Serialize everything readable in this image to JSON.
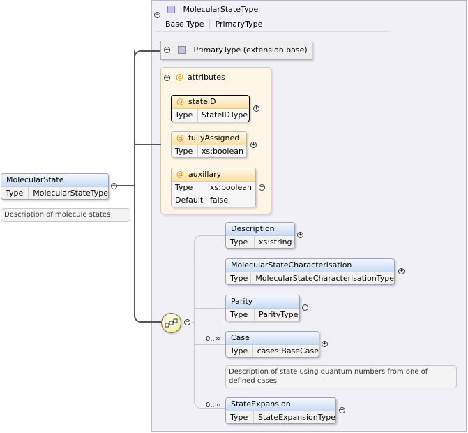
{
  "type_panel": {
    "name": "MolecularStateType",
    "base_type_label": "Base Type",
    "base_type_value": "PrimaryType",
    "extension_label": "PrimaryType (extension base)"
  },
  "attributes_group": {
    "title": "attributes",
    "items": [
      {
        "name": "stateID",
        "rows": [
          {
            "key": "Type",
            "value": "StateIDType"
          }
        ]
      },
      {
        "name": "fullyAssigned",
        "rows": [
          {
            "key": "Type",
            "value": "xs:boolean"
          }
        ]
      },
      {
        "name": "auxillary",
        "rows": [
          {
            "key": "Type",
            "value": "xs:boolean"
          },
          {
            "key": "Default",
            "value": "false"
          }
        ]
      }
    ]
  },
  "root_element": {
    "name": "MolecularState",
    "type_label": "Type",
    "type_value": "MolecularStateType",
    "description": "Description of molecule states"
  },
  "sequence": {
    "children": [
      {
        "name": "Description",
        "type_label": "Type",
        "type_value": "xs:string"
      },
      {
        "name": "MolecularStateCharacterisation",
        "type_label": "Type",
        "type_value": "MolecularStateCharacterisationType"
      },
      {
        "name": "Parity",
        "type_label": "Type",
        "type_value": "ParityType"
      },
      {
        "name": "Case",
        "type_label": "Type",
        "type_value": "cases:BaseCase",
        "multiplicity": "0..∞",
        "description": "Description of state using quantum numbers from one of defined cases"
      },
      {
        "name": "StateExpansion",
        "type_label": "Type",
        "type_value": "StateExpansionType",
        "multiplicity": "0..∞"
      }
    ]
  },
  "colors": {
    "element_header": "#c9dbf5",
    "attribute_header": "#fde0a8",
    "panel_background": "#f0f0f6",
    "attribute_marker": "#e08a00"
  }
}
